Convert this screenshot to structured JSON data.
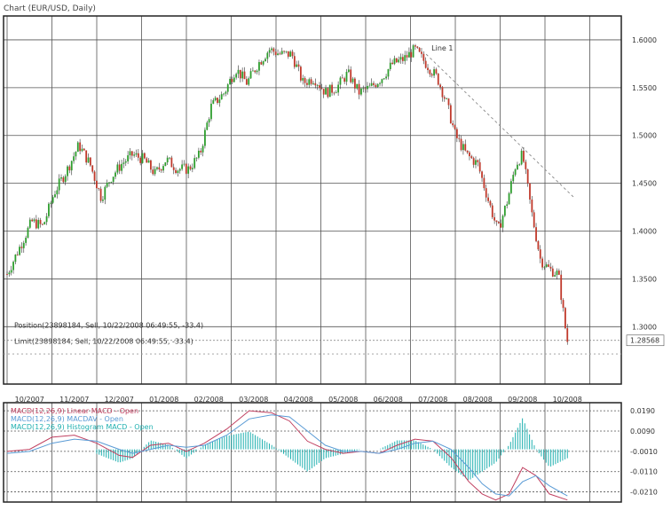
{
  "chart_data": {
    "type": "candlestick",
    "title": "Chart (EUR/USD, Daily)",
    "x_tick_labels": [
      "10/2007",
      "11/2007",
      "12/2007",
      "01/2008",
      "02/2008",
      "03/2008",
      "04/2008",
      "05/2008",
      "06/2008",
      "07/2008",
      "08/2008",
      "09/2008",
      "10/2008"
    ],
    "y_tick_labels": [
      "1.6000",
      "1.5500",
      "1.5000",
      "1.4500",
      "1.4000",
      "1.3500",
      "1.3000"
    ],
    "ylim": [
      1.24,
      1.625
    ],
    "current_price_label": "1.28568",
    "annotations": {
      "trendline_label": "Line 1",
      "position_label": "Position(23898184, Sell, 10/22/2008 06:49:55, -33.4)",
      "limit_label": "Limit(23898184, Sell, 10/22/2008 06:49:55, -33.4)"
    },
    "price_path": [
      {
        "m": 0.0,
        "p": 1.355
      },
      {
        "m": 0.3,
        "p": 1.385
      },
      {
        "m": 0.55,
        "p": 1.41
      },
      {
        "m": 0.8,
        "p": 1.405
      },
      {
        "m": 1.05,
        "p": 1.44
      },
      {
        "m": 1.35,
        "p": 1.465
      },
      {
        "m": 1.6,
        "p": 1.49
      },
      {
        "m": 1.85,
        "p": 1.47
      },
      {
        "m": 2.1,
        "p": 1.435
      },
      {
        "m": 2.3,
        "p": 1.455
      },
      {
        "m": 2.55,
        "p": 1.47
      },
      {
        "m": 2.8,
        "p": 1.48
      },
      {
        "m": 3.05,
        "p": 1.475
      },
      {
        "m": 3.3,
        "p": 1.46
      },
      {
        "m": 3.55,
        "p": 1.475
      },
      {
        "m": 3.8,
        "p": 1.465
      },
      {
        "m": 4.05,
        "p": 1.465
      },
      {
        "m": 4.3,
        "p": 1.48
      },
      {
        "m": 4.55,
        "p": 1.53
      },
      {
        "m": 4.85,
        "p": 1.545
      },
      {
        "m": 5.1,
        "p": 1.57
      },
      {
        "m": 5.35,
        "p": 1.555
      },
      {
        "m": 5.6,
        "p": 1.575
      },
      {
        "m": 5.85,
        "p": 1.59
      },
      {
        "m": 6.1,
        "p": 1.585
      },
      {
        "m": 6.35,
        "p": 1.585
      },
      {
        "m": 6.6,
        "p": 1.555
      },
      {
        "m": 6.85,
        "p": 1.56
      },
      {
        "m": 7.1,
        "p": 1.545
      },
      {
        "m": 7.35,
        "p": 1.55
      },
      {
        "m": 7.6,
        "p": 1.565
      },
      {
        "m": 7.85,
        "p": 1.545
      },
      {
        "m": 8.1,
        "p": 1.55
      },
      {
        "m": 8.35,
        "p": 1.56
      },
      {
        "m": 8.6,
        "p": 1.575
      },
      {
        "m": 8.85,
        "p": 1.58
      },
      {
        "m": 9.1,
        "p": 1.59
      },
      {
        "m": 9.35,
        "p": 1.575
      },
      {
        "m": 9.6,
        "p": 1.56
      },
      {
        "m": 9.8,
        "p": 1.535
      },
      {
        "m": 10.0,
        "p": 1.5
      },
      {
        "m": 10.25,
        "p": 1.48
      },
      {
        "m": 10.5,
        "p": 1.47
      },
      {
        "m": 10.75,
        "p": 1.43
      },
      {
        "m": 10.95,
        "p": 1.4
      },
      {
        "m": 11.15,
        "p": 1.43
      },
      {
        "m": 11.35,
        "p": 1.47
      },
      {
        "m": 11.5,
        "p": 1.48
      },
      {
        "m": 11.7,
        "p": 1.42
      },
      {
        "m": 11.9,
        "p": 1.37
      },
      {
        "m": 12.1,
        "p": 1.36
      },
      {
        "m": 12.3,
        "p": 1.355
      },
      {
        "m": 12.45,
        "p": 1.3
      },
      {
        "m": 12.5,
        "p": 1.285
      }
    ],
    "trendline": {
      "from": {
        "m": 9.35,
        "p": 1.585
      },
      "to": {
        "m": 12.65,
        "p": 1.435
      }
    },
    "position_price": 1.2857,
    "limit_price": 1.2715
  },
  "macd_panel": {
    "legend": [
      {
        "text": "MACD(12,26,9) Linear MACD - Open",
        "color": "#c04060"
      },
      {
        "text": "MACD(12,26,9) MACDAV - Open",
        "color": "#5a9bd5"
      },
      {
        "text": "MACD(12,26,9) Histogram MACD - Open",
        "color": "#20b0b0"
      }
    ],
    "y_tick_labels": [
      "0.0190",
      "0.0090",
      "-0.0010",
      "-0.0110",
      "-0.0210"
    ],
    "ylim": [
      -0.026,
      0.023
    ],
    "macd_path": [
      {
        "m": 0.0,
        "v": -0.001
      },
      {
        "m": 0.5,
        "v": 0.0
      },
      {
        "m": 1.0,
        "v": 0.006
      },
      {
        "m": 1.5,
        "v": 0.007
      },
      {
        "m": 2.0,
        "v": 0.003
      },
      {
        "m": 2.5,
        "v": -0.003
      },
      {
        "m": 2.8,
        "v": -0.004
      },
      {
        "m": 3.2,
        "v": 0.002
      },
      {
        "m": 3.6,
        "v": 0.003
      },
      {
        "m": 4.0,
        "v": -0.001
      },
      {
        "m": 4.4,
        "v": 0.003
      },
      {
        "m": 4.9,
        "v": 0.01
      },
      {
        "m": 5.4,
        "v": 0.019
      },
      {
        "m": 5.9,
        "v": 0.018
      },
      {
        "m": 6.3,
        "v": 0.014
      },
      {
        "m": 6.7,
        "v": 0.004
      },
      {
        "m": 7.1,
        "v": 0.0
      },
      {
        "m": 7.5,
        "v": -0.002
      },
      {
        "m": 7.9,
        "v": -0.001
      },
      {
        "m": 8.3,
        "v": -0.002
      },
      {
        "m": 8.7,
        "v": 0.002
      },
      {
        "m": 9.1,
        "v": 0.005
      },
      {
        "m": 9.5,
        "v": 0.004
      },
      {
        "m": 9.9,
        "v": -0.004
      },
      {
        "m": 10.3,
        "v": -0.016
      },
      {
        "m": 10.6,
        "v": -0.022
      },
      {
        "m": 10.9,
        "v": -0.025
      },
      {
        "m": 11.2,
        "v": -0.022
      },
      {
        "m": 11.5,
        "v": -0.009
      },
      {
        "m": 11.8,
        "v": -0.013
      },
      {
        "m": 12.1,
        "v": -0.022
      },
      {
        "m": 12.5,
        "v": -0.025
      }
    ],
    "signal_path": [
      {
        "m": 0.0,
        "v": -0.002
      },
      {
        "m": 0.5,
        "v": -0.001
      },
      {
        "m": 1.0,
        "v": 0.003
      },
      {
        "m": 1.5,
        "v": 0.005
      },
      {
        "m": 2.0,
        "v": 0.004
      },
      {
        "m": 2.5,
        "v": 0.0
      },
      {
        "m": 2.8,
        "v": -0.002
      },
      {
        "m": 3.2,
        "v": 0.0
      },
      {
        "m": 3.6,
        "v": 0.002
      },
      {
        "m": 4.0,
        "v": 0.001
      },
      {
        "m": 4.4,
        "v": 0.002
      },
      {
        "m": 4.9,
        "v": 0.007
      },
      {
        "m": 5.4,
        "v": 0.015
      },
      {
        "m": 5.9,
        "v": 0.017
      },
      {
        "m": 6.3,
        "v": 0.016
      },
      {
        "m": 6.7,
        "v": 0.009
      },
      {
        "m": 7.1,
        "v": 0.002
      },
      {
        "m": 7.5,
        "v": -0.001
      },
      {
        "m": 7.9,
        "v": -0.001
      },
      {
        "m": 8.3,
        "v": -0.002
      },
      {
        "m": 8.7,
        "v": 0.0
      },
      {
        "m": 9.1,
        "v": 0.003
      },
      {
        "m": 9.5,
        "v": 0.004
      },
      {
        "m": 9.9,
        "v": 0.0
      },
      {
        "m": 10.3,
        "v": -0.009
      },
      {
        "m": 10.6,
        "v": -0.017
      },
      {
        "m": 10.9,
        "v": -0.022
      },
      {
        "m": 11.2,
        "v": -0.023
      },
      {
        "m": 11.5,
        "v": -0.016
      },
      {
        "m": 11.8,
        "v": -0.013
      },
      {
        "m": 12.1,
        "v": -0.018
      },
      {
        "m": 12.5,
        "v": -0.023
      }
    ]
  }
}
